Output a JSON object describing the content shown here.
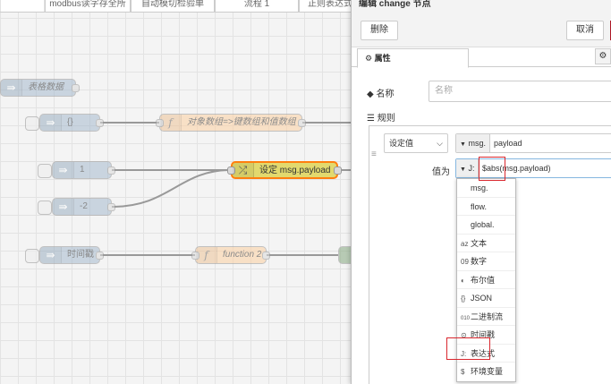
{
  "workspace": {
    "tabs": [
      "modbus读字存全所",
      "自动模切检验单",
      "流程 1",
      "正则表达式"
    ],
    "nodes": {
      "table_data": "表格数据",
      "braces": "{}",
      "obj_to_arrays": "对象数组=>键数组和值数组",
      "one": "1",
      "change_node": "设定 msg.payload",
      "minus_two": "-2",
      "timestamp": "时间戳",
      "function2": "function 2"
    },
    "icons": {
      "inject": "arrow-icon",
      "function": "function-icon",
      "change": "shuffle-icon"
    },
    "colors": {
      "inject": "#a6bbcf",
      "function": "#fdd0a2",
      "change": "#e2d96e",
      "selected": "#ff7f0e"
    }
  },
  "editor": {
    "title": "编辑 change 节点",
    "delete_label": "删除",
    "cancel_label": "取消",
    "properties_tab": "属性",
    "name_label": "名称",
    "name_placeholder": "名称",
    "rules_label": "规则",
    "rule": {
      "action": "设定值",
      "target_prefix": "msg.",
      "target_value": "payload",
      "to_label": "值为",
      "value_type_glyph": "J:",
      "value": "$abs(msg.payload)"
    },
    "type_menu": [
      {
        "glyph": "",
        "label": "msg."
      },
      {
        "glyph": "",
        "label": "flow."
      },
      {
        "glyph": "",
        "label": "global."
      },
      {
        "glyph": "az",
        "label": "文本"
      },
      {
        "glyph": "09",
        "label": "数字"
      },
      {
        "glyph": "◐",
        "label": "布尔值"
      },
      {
        "glyph": "{}",
        "label": "JSON"
      },
      {
        "glyph": "010",
        "label": "二进制流"
      },
      {
        "glyph": "⊙",
        "label": "时间戳"
      },
      {
        "glyph": "J:",
        "label": "表达式"
      },
      {
        "glyph": "$",
        "label": "环境变量"
      }
    ]
  }
}
